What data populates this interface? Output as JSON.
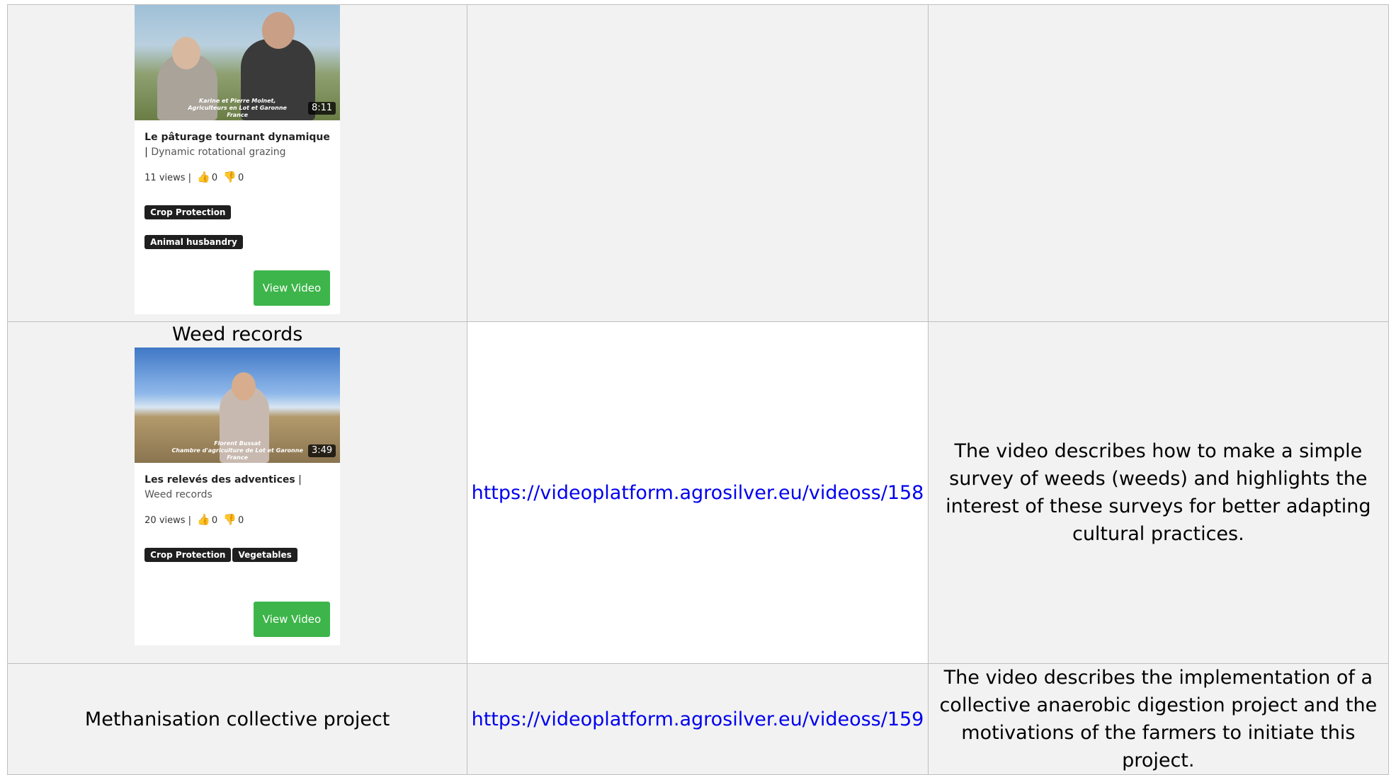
{
  "rows": [
    {
      "card": {
        "duration": "8:11",
        "caption_line1": "Karine et Pierre Molnet,",
        "caption_line2": "Agriculteurs en Lot et Garonne",
        "caption_line3": "France",
        "title_main": "Le pâturage tournant dynamique",
        "title_sep": " | ",
        "title_sub": "Dynamic rotational grazing",
        "views": "11 views",
        "likes": "0",
        "dislikes": "0",
        "tags": [
          "Crop Protection",
          "Animal husbandry"
        ],
        "button": "View Video"
      }
    },
    {
      "heading": "Weed records",
      "card": {
        "duration": "3:49",
        "caption_line1": "Florent Bussat",
        "caption_line2": "Chambre d'agriculture de Lot et Garonne",
        "caption_line3": "France",
        "title_main": "Les relevés des adventices",
        "title_sep": " | ",
        "title_sub": "Weed records",
        "views": "20 views",
        "likes": "0",
        "dislikes": "0",
        "tags": [
          "Crop Protection",
          "Vegetables"
        ],
        "button": "View Video"
      },
      "link": "https://videoplatform.agrosilver.eu/videoss/158",
      "description": "The video describes how to make a simple survey of weeds (weeds) and highlights the interest of these surveys for better adapting cultural practices."
    },
    {
      "heading": "Methanisation collective project",
      "link": "https://videoplatform.agrosilver.eu/videoss/159",
      "description": "The video describes the implementation of a collective anaerobic digestion project and the motivations of the farmers to initiate this project."
    }
  ],
  "colors": {
    "button": "#3db54a",
    "tag": "#1f1f1f",
    "link": "#0000ee",
    "shade": "#f2f2f2"
  }
}
